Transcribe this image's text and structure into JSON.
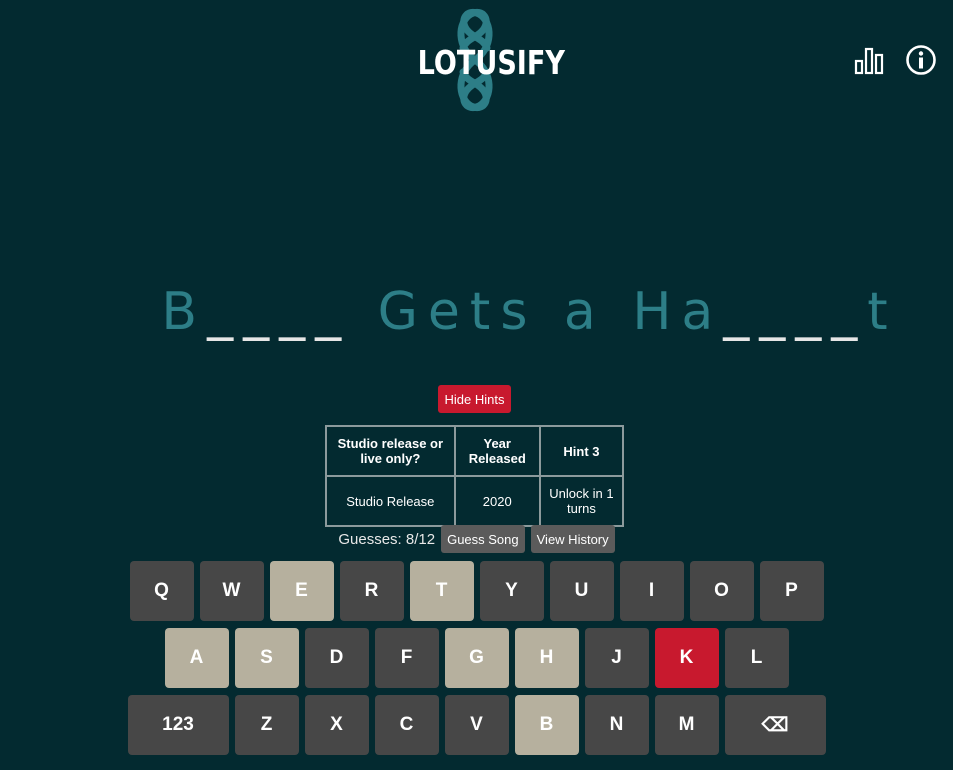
{
  "header": {
    "logo_text": "LOTUSIFY",
    "icons": [
      "stats-icon",
      "info-icon"
    ],
    "logo_color": "#2d7e87"
  },
  "puzzle": {
    "segments": [
      {
        "text": "B",
        "type": "letter"
      },
      {
        "text": "____",
        "type": "blank"
      },
      {
        "text": " Gets a Ha",
        "type": "letter"
      },
      {
        "text": "____",
        "type": "blank"
      },
      {
        "text": "t",
        "type": "letter"
      }
    ]
  },
  "hints": {
    "toggle_label": "Hide Hints",
    "headers": [
      "Studio release or live only?",
      "Year Released",
      "Hint 3"
    ],
    "values": [
      "Studio Release",
      "2020",
      "Unlock in 1 turns"
    ]
  },
  "guesses": {
    "label": "Guesses: 8/12",
    "guess_button": "Guess Song",
    "history_button": "View History"
  },
  "keyboard": {
    "rows": [
      [
        {
          "label": "Q",
          "state": "default"
        },
        {
          "label": "W",
          "state": "default"
        },
        {
          "label": "E",
          "state": "used"
        },
        {
          "label": "R",
          "state": "default"
        },
        {
          "label": "T",
          "state": "used"
        },
        {
          "label": "Y",
          "state": "default"
        },
        {
          "label": "U",
          "state": "default"
        },
        {
          "label": "I",
          "state": "default"
        },
        {
          "label": "O",
          "state": "default"
        },
        {
          "label": "P",
          "state": "default"
        }
      ],
      [
        {
          "label": "A",
          "state": "used"
        },
        {
          "label": "S",
          "state": "used"
        },
        {
          "label": "D",
          "state": "default"
        },
        {
          "label": "F",
          "state": "default"
        },
        {
          "label": "G",
          "state": "used"
        },
        {
          "label": "H",
          "state": "used"
        },
        {
          "label": "J",
          "state": "default"
        },
        {
          "label": "K",
          "state": "wrong"
        },
        {
          "label": "L",
          "state": "default"
        }
      ],
      [
        {
          "label": "123",
          "state": "default",
          "wide": true
        },
        {
          "label": "Z",
          "state": "default"
        },
        {
          "label": "X",
          "state": "default"
        },
        {
          "label": "C",
          "state": "default"
        },
        {
          "label": "V",
          "state": "default"
        },
        {
          "label": "B",
          "state": "used"
        },
        {
          "label": "N",
          "state": "default"
        },
        {
          "label": "M",
          "state": "default"
        },
        {
          "label": "⌫",
          "state": "default",
          "wide": true
        }
      ]
    ],
    "colors": {
      "default": "#474747",
      "used": "#b6b09e",
      "wrong": "#c8192e"
    }
  }
}
